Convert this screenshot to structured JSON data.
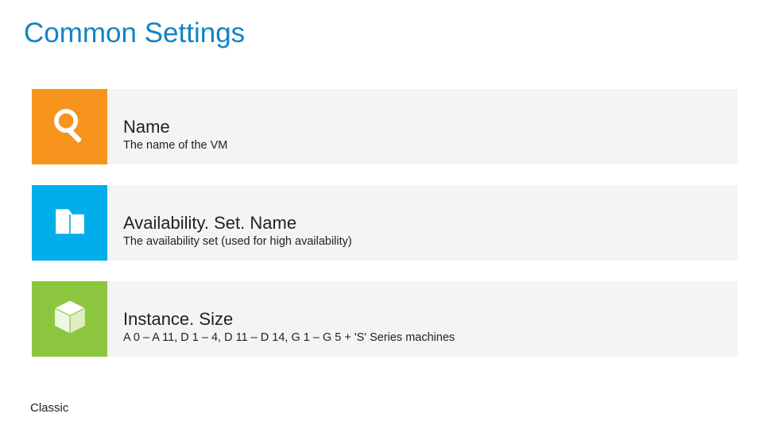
{
  "title": "Common Settings",
  "rows": [
    {
      "icon": "search-icon",
      "color": "#f7941e",
      "title": "Name",
      "desc": "The name of the VM"
    },
    {
      "icon": "folder-icon",
      "color": "#00aeea",
      "title": "Availability. Set. Name",
      "desc": "The availability set (used for high availability)"
    },
    {
      "icon": "cube-icon",
      "color": "#8cc63f",
      "title": "Instance. Size",
      "desc": "A 0 – A 11, D 1 – 4, D 11 – D 14, G 1 – G 5 + 'S' Series machines"
    }
  ],
  "footer": "Classic"
}
